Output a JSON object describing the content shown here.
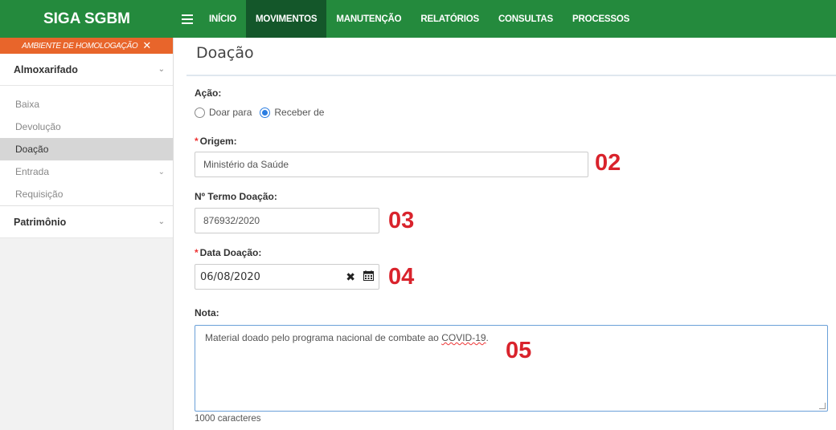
{
  "app": {
    "title": "SIGA SGBM",
    "menu_icon": "hamburger-icon"
  },
  "nav": {
    "items": [
      {
        "label": "INÍCIO",
        "active": false
      },
      {
        "label": "MOVIMENTOS",
        "active": true
      },
      {
        "label": "MANUTENÇÃO",
        "active": false
      },
      {
        "label": "RELATÓRIOS",
        "active": false
      },
      {
        "label": "CONSULTAS",
        "active": false
      },
      {
        "label": "PROCESSOS",
        "active": false
      }
    ]
  },
  "env_banner": {
    "label": "AMBIENTE DE HOMOLOGAÇÃO",
    "icon": "tools-icon",
    "color": "#e8652b"
  },
  "sidebar": {
    "section1": {
      "label": "Almoxarifado",
      "items": [
        {
          "label": "Baixa"
        },
        {
          "label": "Devolução"
        },
        {
          "label": "Doação",
          "active": true
        },
        {
          "label": "Entrada",
          "has_submenu": true
        },
        {
          "label": "Requisição"
        }
      ]
    },
    "section2": {
      "label": "Patrimônio"
    }
  },
  "page": {
    "title": "Doação"
  },
  "form": {
    "acao": {
      "label": "Ação:",
      "options": [
        {
          "label": "Doar para",
          "checked": false
        },
        {
          "label": "Receber de",
          "checked": true
        }
      ]
    },
    "origem": {
      "label": "Origem:",
      "required": true,
      "value": "Ministério da Saúde",
      "marker": "02"
    },
    "termo": {
      "label": "Nº Termo Doação:",
      "required": false,
      "value": "876932/2020",
      "marker": "03"
    },
    "data": {
      "label": "Data Doação:",
      "required": true,
      "value": "06/08/2020",
      "marker": "04"
    },
    "nota": {
      "label": "Nota:",
      "value_before": "Material doado pelo programa nacional de combate ao ",
      "value_flagged": "COVID-19",
      "value_after": ".",
      "marker": "05",
      "counter": "1000 caracteres"
    }
  },
  "colors": {
    "brand_green": "#248a3d",
    "active_nav": "#14572a",
    "marker_red": "#d9232c"
  }
}
